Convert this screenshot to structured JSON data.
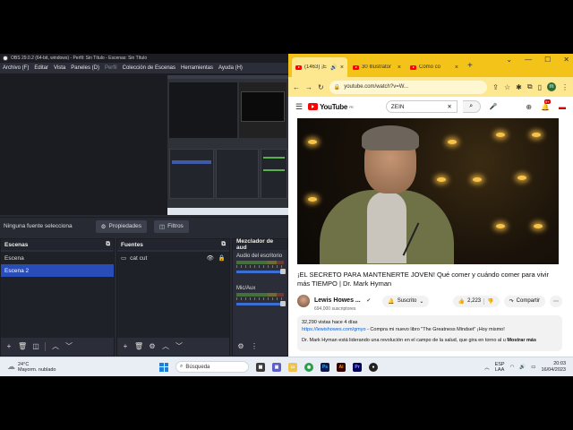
{
  "obs": {
    "title": "OBS 29.0.2 (64-bit, windows) - Perfil: Sin Título - Escenas: Sin Título",
    "menu": [
      "Archivo (F)",
      "Editar",
      "Vista",
      "Paneles (D)",
      "Perfil",
      "Colección de Escenas",
      "Herramientas",
      "Ayuda (H)"
    ],
    "source_bar": {
      "no_source": "Ninguna fuente selecciona",
      "properties": "Propiedades",
      "filters": "Filtros"
    },
    "scenes": {
      "title": "Escenas",
      "items": [
        "Escena",
        "Escena 2"
      ],
      "selected_index": 1
    },
    "sources": {
      "title": "Fuentes",
      "items": [
        "cat cut"
      ]
    },
    "mixer": {
      "title": "Mezclador de aud",
      "channels": [
        "Audio del escritorio",
        "Mic/Aux"
      ]
    }
  },
  "chrome": {
    "tabs": [
      {
        "title": "(1463) ¡E",
        "active": true
      },
      {
        "title": "30 Illustrator",
        "active": false
      },
      {
        "title": "Cómo co",
        "active": false
      }
    ],
    "url": "youtube.com/watch?v=W...",
    "profile_initial": "m"
  },
  "youtube": {
    "logo": "YouTube",
    "region": "PE",
    "search_query": "ZEIN",
    "notifications": "9+",
    "video_title": "¡EL SECRETO PARA MANTENERTE JOVEN! Qué comer y cuándo comer para vivir más TIEMPO | Dr. Mark Hyman",
    "channel_name": "Lewis Howes ...",
    "subscribers": "694,000 suscriptores",
    "subscribed_label": "Suscrito",
    "likes": "2,223",
    "share_label": "Compartir",
    "views_date": "32,290 vistas  hace 4 días",
    "desc_link": "https://lewishowes.com/gmyo",
    "desc_line1_rest": " - Compra mi nuevo libro \"The Greatness Mindset\" ¡Hoy mismo!",
    "desc_line2": "Dr. Mark Hyman está liderando una revolución en el campo de la salud, que gira en torno al u",
    "more_label": "Mostrar más"
  },
  "taskbar": {
    "temperature": "24°C",
    "weather_desc": "Mayorm. nublado",
    "search_label": "Búsqueda",
    "lang_top": "ESP",
    "lang_bottom": "LAA",
    "time": "20:03",
    "date": "16/04/2023"
  },
  "colors": {
    "obs_bg": "#272a33",
    "obs_selected": "#284cb8",
    "chrome_frame": "#f4c31a",
    "youtube_red": "#ff0000"
  }
}
